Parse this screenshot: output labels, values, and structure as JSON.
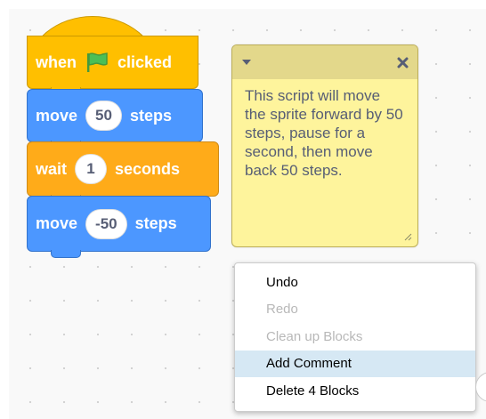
{
  "script": {
    "hat": {
      "prefix": "when",
      "suffix": "clicked",
      "icon": "green-flag-icon"
    },
    "move1": {
      "label": "move",
      "value": "50",
      "unit": "steps"
    },
    "wait": {
      "label": "wait",
      "value": "1",
      "unit": "seconds"
    },
    "move2": {
      "label": "move",
      "value": "-50",
      "unit": "steps"
    }
  },
  "comment": {
    "text": "This script will move the sprite forward by 50 steps, pause for a second, then move back 50 steps.",
    "collapse_icon": "caret-down-icon",
    "close_icon": "close-x-icon"
  },
  "context_menu": {
    "items": [
      {
        "label": "Undo",
        "enabled": true
      },
      {
        "label": "Redo",
        "enabled": false
      },
      {
        "label": "Clean up Blocks",
        "enabled": false
      },
      {
        "label": "Add Comment",
        "enabled": true,
        "highlighted": true
      },
      {
        "label": "Delete 4 Blocks",
        "enabled": true
      }
    ]
  },
  "colors": {
    "events": "#ffbf00",
    "motion": "#4c97ff",
    "control": "#ffab19",
    "comment": "#fef49c",
    "menu_highlight": "#d6e8f4"
  }
}
